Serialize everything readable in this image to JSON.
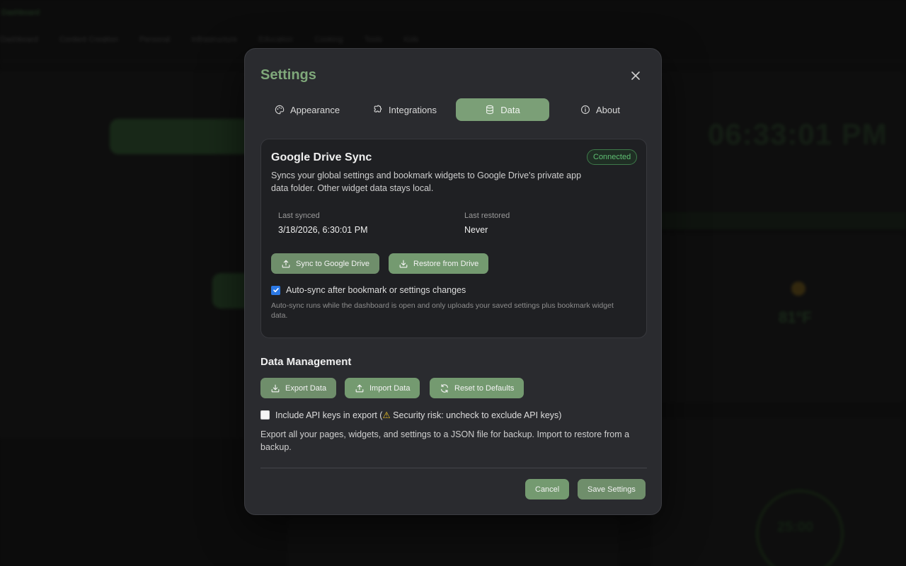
{
  "background": {
    "tabs": [
      "Dashboard",
      "Content Creation",
      "Personal",
      "Infrastructure",
      "Education",
      "Cooking",
      "Tools",
      "Kids"
    ],
    "clock": "06:33:01 PM",
    "temperature": "81°F",
    "timer": "25:00"
  },
  "modal": {
    "title": "Settings",
    "close_icon": "close-icon",
    "tabs": [
      {
        "label": "Appearance",
        "icon": "palette-icon",
        "active": false
      },
      {
        "label": "Integrations",
        "icon": "puzzle-icon",
        "active": false
      },
      {
        "label": "Data",
        "icon": "database-icon",
        "active": true
      },
      {
        "label": "About",
        "icon": "info-icon",
        "active": false
      }
    ],
    "sync": {
      "title": "Google Drive Sync",
      "status": "Connected",
      "description": "Syncs your global settings and bookmark widgets to Google Drive's private app data folder. Other widget data stays local.",
      "last_synced_label": "Last synced",
      "last_synced_value": "3/18/2026, 6:30:01 PM",
      "last_restored_label": "Last restored",
      "last_restored_value": "Never",
      "sync_button": "Sync to Google Drive",
      "restore_button": "Restore from Drive",
      "autosync_label": "Auto-sync after bookmark or settings changes",
      "autosync_checked": true,
      "note": "Auto-sync runs while the dashboard is open and only uploads your saved settings plus bookmark widget data."
    },
    "data_management": {
      "title": "Data Management",
      "export_button": "Export Data",
      "import_button": "Import Data",
      "reset_button": "Reset to Defaults",
      "include_keys_label_prefix": "Include API keys in export (",
      "warning_glyph": "⚠",
      "include_keys_label_suffix": " Security risk: uncheck to exclude API keys)",
      "include_keys_checked": false,
      "description": "Export all your pages, widgets, and settings to a JSON file for backup. Import to restore from a backup."
    },
    "footer": {
      "cancel_button": "Cancel",
      "save_button": "Save Settings"
    }
  },
  "colors": {
    "accent": "#7b9f77",
    "title": "#7fa87a",
    "connected": "#5fbf73",
    "checkbox": "#2b78e4",
    "warning": "#f3c623"
  }
}
